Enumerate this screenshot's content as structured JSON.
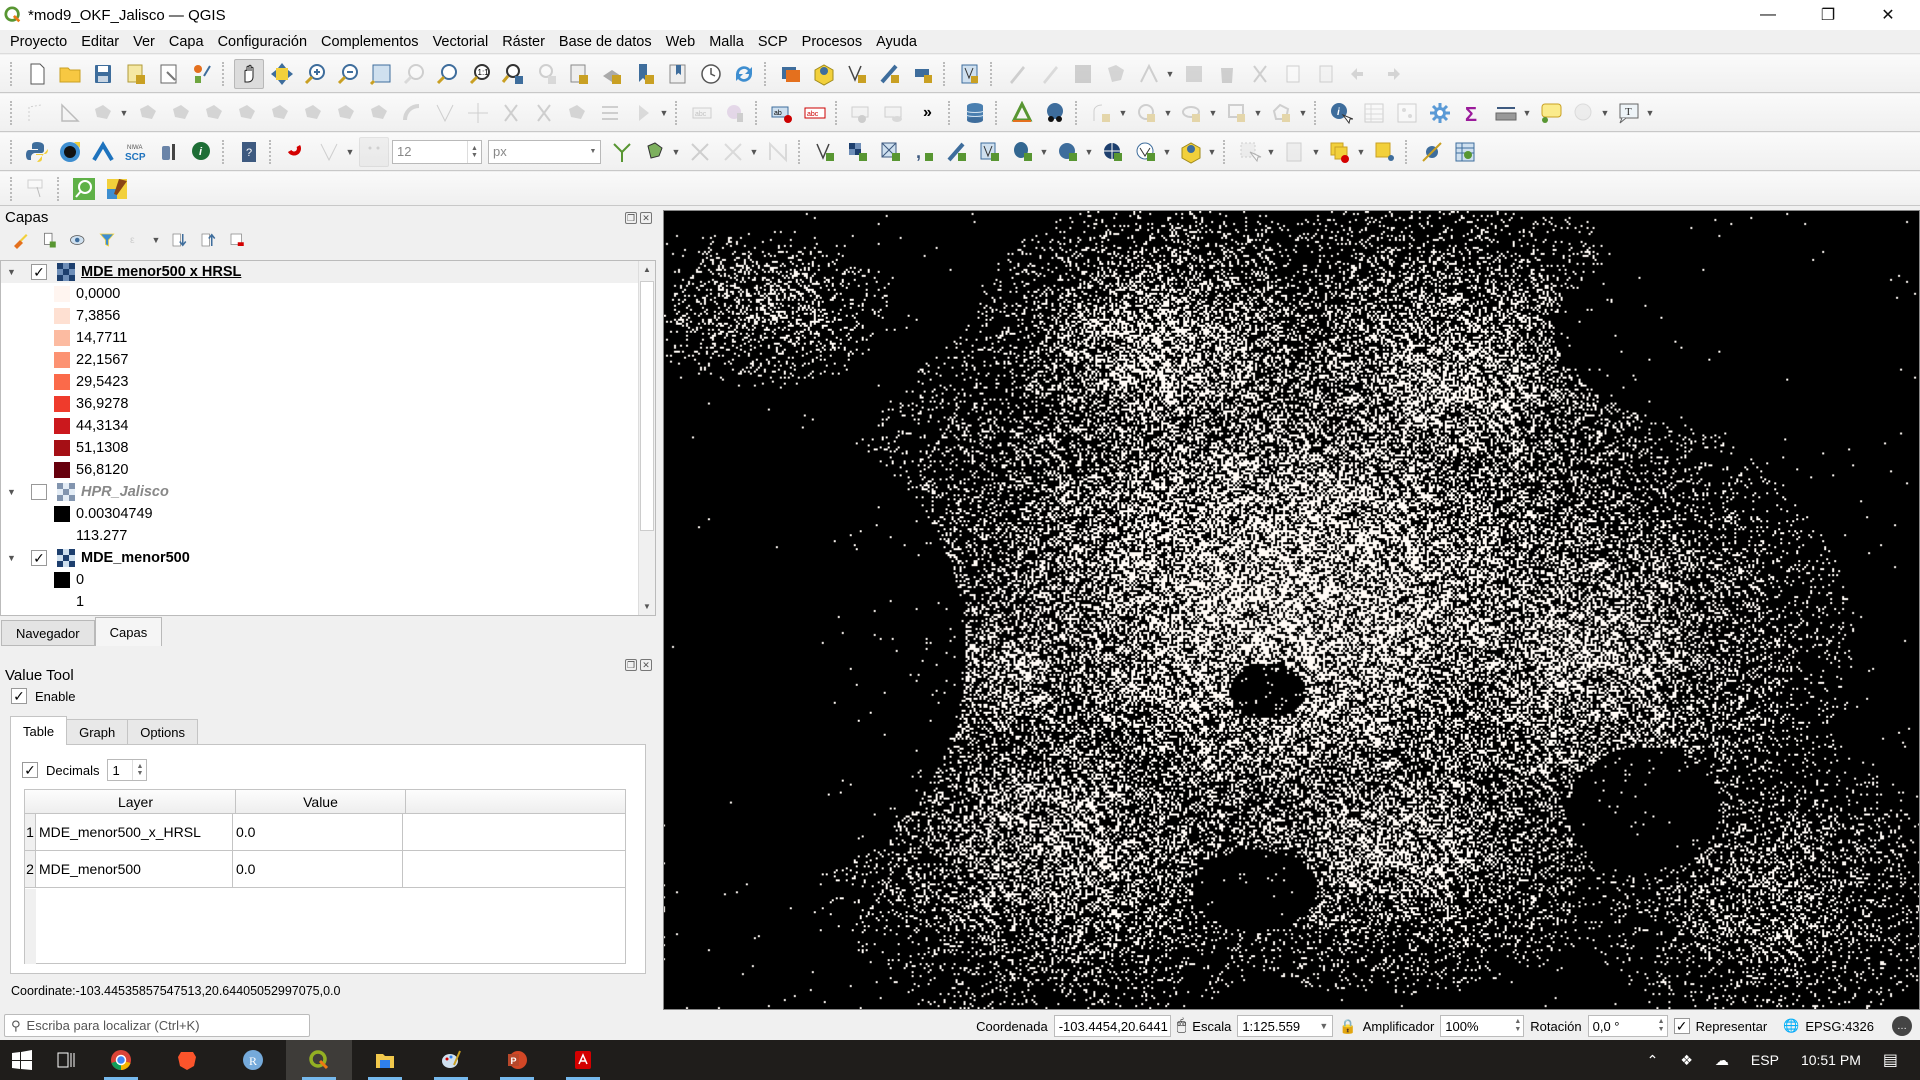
{
  "window": {
    "title": "*mod9_OKF_Jalisco — QGIS",
    "minimize_icon": "minimize-icon",
    "maximize_icon": "restore-icon",
    "close_icon": "close-icon"
  },
  "menubar": {
    "items": [
      "Proyecto",
      "Editar",
      "Ver",
      "Capa",
      "Configuración",
      "Complementos",
      "Vectorial",
      "Ráster",
      "Base de datos",
      "Web",
      "Malla",
      "SCP",
      "Procesos",
      "Ayuda"
    ]
  },
  "toolbars": {
    "snapping_tolerance": "12",
    "snapping_units": "px",
    "overflow_label": "»"
  },
  "layers_panel": {
    "title": "Capas",
    "layers": [
      {
        "name": "MDE_menor500_x_HRSL",
        "display_name": "MDE menor500 x HRSL",
        "visible": true,
        "legend": [
          {
            "label": "0,0000",
            "color": "#fff5f0"
          },
          {
            "label": "7,3856",
            "color": "#fee0d2"
          },
          {
            "label": "14,7711",
            "color": "#fcbba1"
          },
          {
            "label": "22,1567",
            "color": "#fc9272"
          },
          {
            "label": "29,5423",
            "color": "#fb6a4a"
          },
          {
            "label": "36,9278",
            "color": "#ef3b2c"
          },
          {
            "label": "44,3134",
            "color": "#cb181d"
          },
          {
            "label": "51,1308",
            "color": "#a50f15"
          },
          {
            "label": "56,8120",
            "color": "#67000d"
          }
        ]
      },
      {
        "name": "HPR_Jalisco",
        "display_name": "HPR_Jalisco",
        "visible": false,
        "legend": [
          {
            "label": "0.00304749",
            "color": "#000000"
          },
          {
            "label": "113.277",
            "color": "#ffffff"
          }
        ]
      },
      {
        "name": "MDE_menor500",
        "display_name": "MDE_menor500",
        "visible": true,
        "legend": [
          {
            "label": "0",
            "color": "#000000"
          },
          {
            "label": "1",
            "color": "#ffffff"
          }
        ]
      }
    ]
  },
  "panel_tabs": [
    "Navegador",
    "Capas"
  ],
  "value_tool": {
    "title": "Value Tool",
    "enable_label": "Enable",
    "enabled": true,
    "tabs": [
      "Table",
      "Graph",
      "Options"
    ],
    "decimals_label": "Decimals",
    "decimals_checked": true,
    "decimals_value": "1",
    "columns": [
      "Layer",
      "Value"
    ],
    "rows": [
      {
        "num": "1",
        "layer": "MDE_menor500_x_HRSL",
        "value": "0.0"
      },
      {
        "num": "2",
        "layer": "MDE_menor500",
        "value": "0.0"
      }
    ],
    "coordinate": "Coordinate:-103.44535857547513,20.64405052997075,0.0"
  },
  "locator": {
    "placeholder": "Escriba para localizar (Ctrl+K)"
  },
  "statusbar": {
    "coord_label": "Coordenada",
    "coord_value": "-103.4454,20.6441",
    "scale_label": "Escala",
    "scale_value": "1:125.559",
    "magnifier_label": "Amplificador",
    "magnifier_value": "100%",
    "rotation_label": "Rotación",
    "rotation_value": "0,0 °",
    "render_label": "Representar",
    "render_checked": true,
    "crs": "EPSG:4326"
  },
  "taskbar": {
    "apps": [
      "start",
      "task-view",
      "chrome",
      "brave",
      "r",
      "qgis",
      "file-explorer",
      "paint",
      "powerpoint",
      "acrobat"
    ],
    "language": "ESP",
    "time": "10:51 PM"
  },
  "colors": {
    "map_background": "#000000",
    "map_foreground": "#ffffff",
    "taskbar": "#1f1d1b",
    "taskbar_accent": "#76b9ed"
  }
}
